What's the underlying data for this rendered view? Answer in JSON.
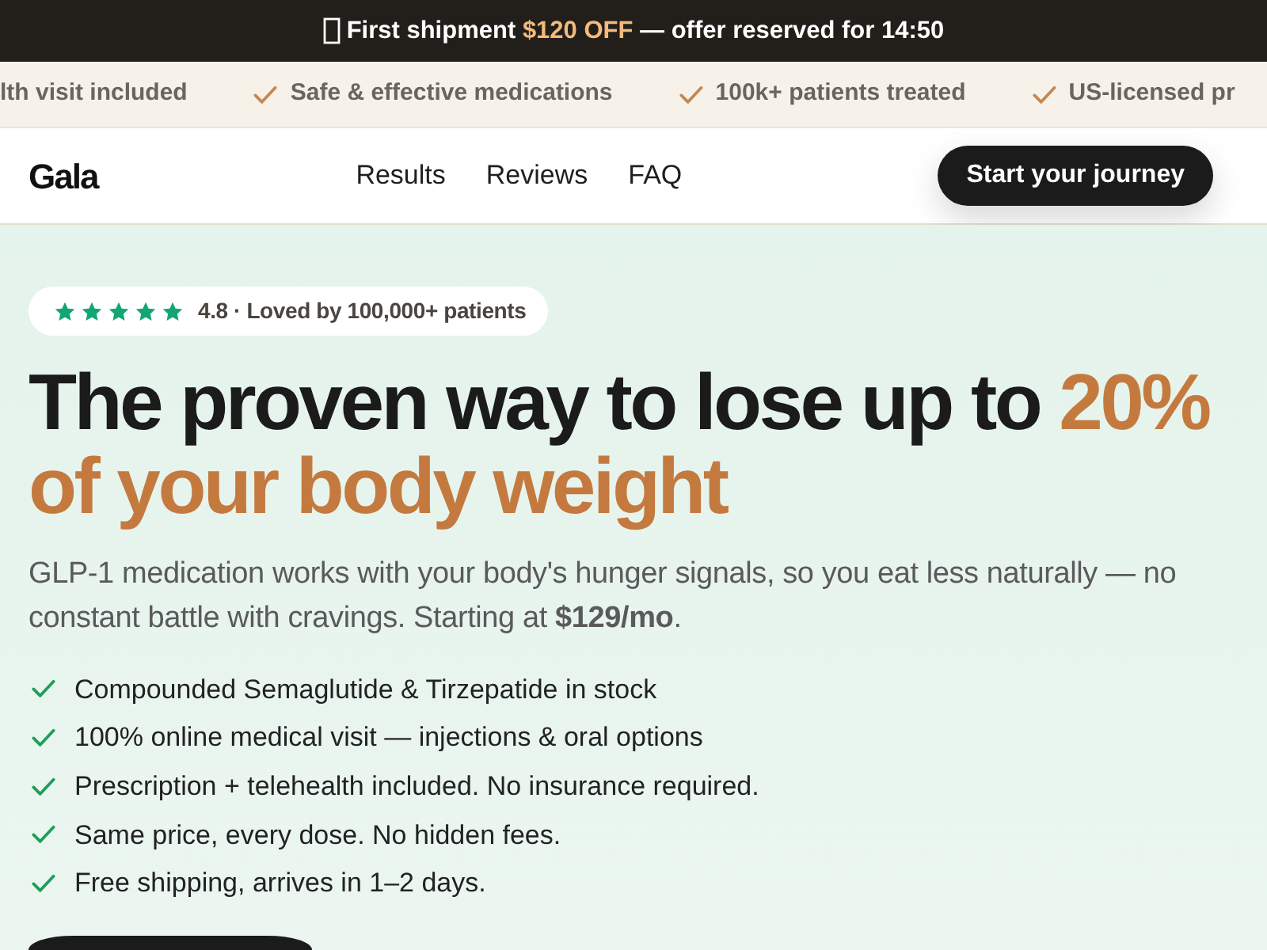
{
  "announcement": {
    "text": "First shipment",
    "highlight": "$120 OFF",
    "suffix": "— offer reserved for",
    "timer": "14:50"
  },
  "trust_bar": {
    "lead_text": "lth visit included",
    "items": [
      "Safe & effective medications",
      "100k+ patients treated",
      "US-licensed pr"
    ]
  },
  "nav": {
    "logo": "Gala",
    "links": [
      "Results",
      "Reviews",
      "FAQ"
    ],
    "cta": "Start your journey"
  },
  "hero": {
    "rating": {
      "stars": 5,
      "text": "4.8 · Loved by 100,000+ patients"
    },
    "heading": {
      "text": "The proven way to lose up to",
      "highlight": "20% of your body weight"
    },
    "subtitle": "GLP-1 medication works with your body's hunger signals, so you eat less naturally — no constant battle with cravings. Starting at **$129/mo**.",
    "benefits": [
      "Compounded Semaglutide & Tirzepatide in stock",
      "100% online medical visit — injections & oral options",
      "Prescription + telehealth included. No insurance required.",
      "Same price, every dose. No hidden fees.",
      "Free shipping, arrives in 1–2 days."
    ]
  }
}
